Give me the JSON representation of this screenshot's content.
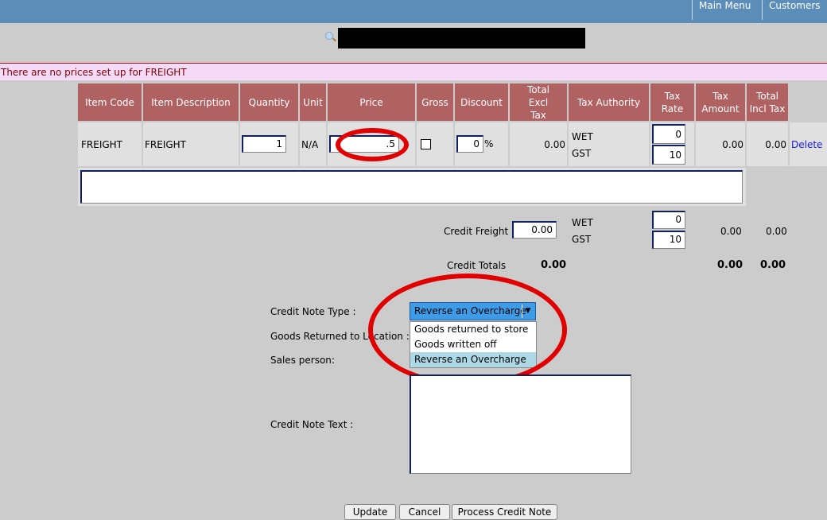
{
  "nav": {
    "main_menu": "Main Menu",
    "customers": "Customers"
  },
  "message": "There are no prices set up for FREIGHT",
  "table": {
    "headers": [
      "Item Code",
      "Item Description",
      "Quantity",
      "Unit",
      "Price",
      "Gross",
      "Discount",
      "Total Excl Tax",
      "Tax Authority",
      "Tax Rate",
      "Tax Amount",
      "Total Incl Tax"
    ],
    "row": {
      "item_code": "FREIGHT",
      "description": "FREIGHT",
      "quantity": "1",
      "unit": "N/A",
      "price": ".5",
      "gross_checked": false,
      "discount": "0",
      "discount_unit": "%",
      "total_excl": "0.00",
      "tax_authorities": [
        "WET",
        "GST"
      ],
      "tax_rates": [
        "0",
        "10"
      ],
      "tax_amount": "0.00",
      "total_incl": "0.00",
      "delete": "Delete"
    }
  },
  "freight": {
    "label": "Credit Freight",
    "value": "0.00",
    "tax_authorities": [
      "WET",
      "GST"
    ],
    "tax_rates": [
      "0",
      "10"
    ],
    "tax_amount": "0.00",
    "total_incl": "0.00"
  },
  "totals": {
    "label": "Credit Totals",
    "excl": "0.00",
    "tax": "0.00",
    "incl": "0.00"
  },
  "form": {
    "credit_note_type_label": "Credit Note Type :",
    "credit_note_type_value": "Reverse an Overcharge",
    "options": [
      "Goods returned to store",
      "Goods written off",
      "Reverse an Overcharge"
    ],
    "goods_returned_label": "Goods Returned to Location :",
    "sales_person_label": "Sales person:",
    "credit_note_text_label": "Credit Note Text :"
  },
  "buttons": {
    "update": "Update",
    "cancel": "Cancel",
    "process": "Process Credit Note"
  },
  "colors": {
    "topbar": "#5b8db8",
    "header": "#b06262",
    "highlight_ring": "#e00000",
    "message_bg": "#f5dbf8"
  }
}
